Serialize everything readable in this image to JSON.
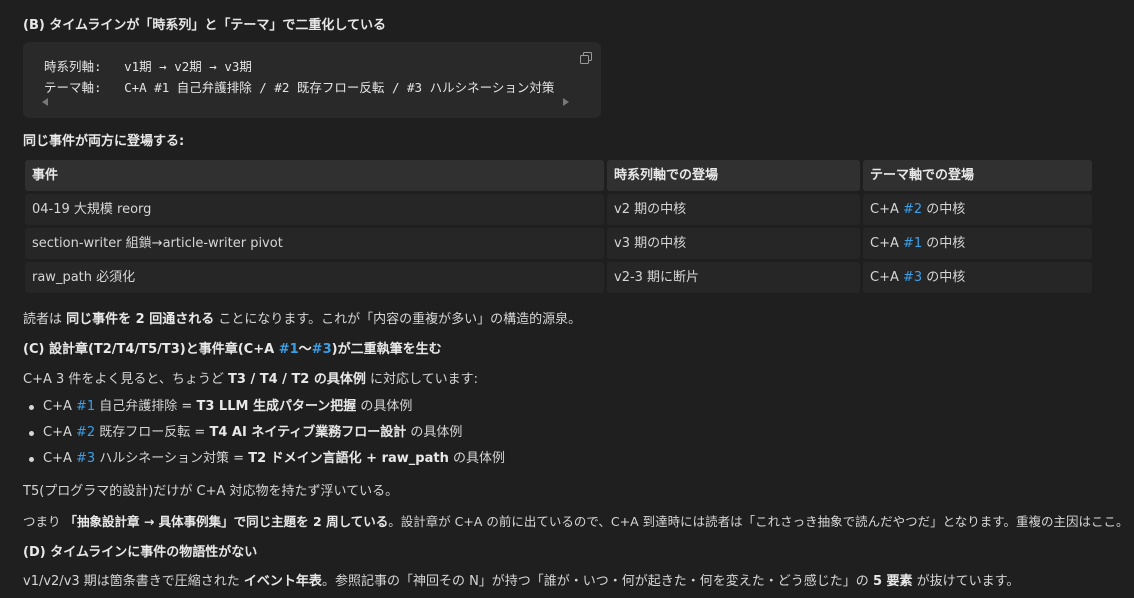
{
  "headings": {
    "b": "(B) タイムラインが「時系列」と「テーマ」で二重化している",
    "c_pre": "(C) 設計章(T2/T4/T5/T3)と事件章(C+A ",
    "c_link1": "#1",
    "c_mid": "〜",
    "c_link2": "#3",
    "c_post": ")が二重執筆を生む",
    "d": "(D) タイムラインに事件の物語性がない"
  },
  "code_block": {
    "line1": "時系列軸:   v1期 → v2期 → v3期",
    "line2": "テーマ軸:   C+A #1 自己弁護排除 / #2 既存フロー反転 / #3 ハルシネーション対策"
  },
  "intro_text": "同じ事件が両方に登場する:",
  "table": {
    "headers": [
      "事件",
      "時系列軸での登場",
      "テーマ軸での登場"
    ],
    "rows": [
      {
        "event": "04-19 大規模 reorg",
        "timeline": "v2 期の中核",
        "theme_pre": "C+A ",
        "theme_link": "#2",
        "theme_post": " の中核"
      },
      {
        "event": "section-writer 組鎖→article-writer pivot",
        "timeline": "v3 期の中核",
        "theme_pre": "C+A ",
        "theme_link": "#1",
        "theme_post": " の中核"
      },
      {
        "event": "raw_path 必須化",
        "timeline": "v2-3 期に断片",
        "theme_pre": "C+A ",
        "theme_link": "#3",
        "theme_post": " の中核"
      }
    ]
  },
  "para_reader": {
    "pre": "読者は ",
    "bold": "同じ事件を 2 回通される",
    "post": " ことになります。これが「内容の重複が多い」の構造的源泉。"
  },
  "para_c": {
    "pre": "C+A 3 件をよく見ると、ちょうど ",
    "bold": "T3 / T4 / T2 の具体例",
    "post": " に対応しています:"
  },
  "bullets": [
    {
      "pre": "C+A ",
      "link": "#1",
      "mid": " 自己弁護排除 = ",
      "bold": "T3 LLM 生成パターン把握",
      "post": " の具体例"
    },
    {
      "pre": "C+A ",
      "link": "#2",
      "mid": " 既存フロー反転 = ",
      "bold": "T4 AI ネイティブ業務フロー設計",
      "post": " の具体例"
    },
    {
      "pre": "C+A ",
      "link": "#3",
      "mid": " ハルシネーション対策 = ",
      "bold": "T2 ドメイン言語化 + raw_path",
      "post": " の具体例"
    }
  ],
  "para_t5": "T5(プログラマ的設計)だけが C+A 対応物を持たず浮いている。",
  "para_tsumari": {
    "pre": "つまり ",
    "bold": "「抽象設計章 → 具体事例集」で同じ主題を 2 周している",
    "post": "。設計章が C+A の前に出ているので、C+A 到達時には読者は「これさっき抽象で読んだやつだ」となります。重複の主因はここ。"
  },
  "para_d": {
    "pre": "v1/v2/v3 期は箇条書きで圧縮された ",
    "bold1": "イベント年表",
    "mid": "。参照記事の「神回その N」が持つ「誰が・いつ・何が起きた・何を変えた・どう感じた」の ",
    "bold2": "5 要素",
    "post": " が抜けています。"
  }
}
